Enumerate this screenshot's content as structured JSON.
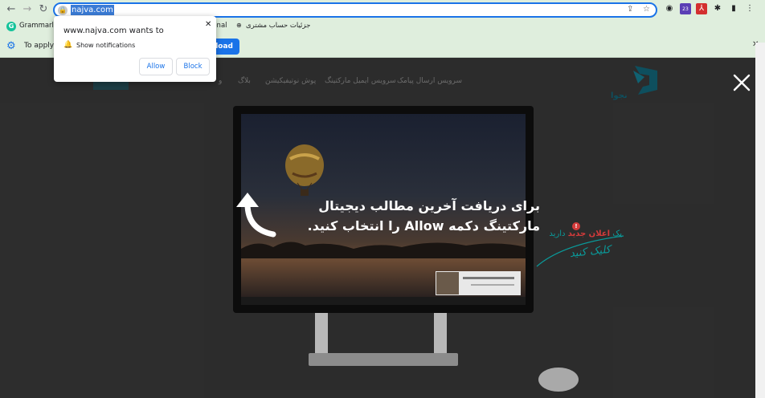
{
  "browser": {
    "url": "najva.com",
    "ext_badge": "23"
  },
  "bookmarks": {
    "grammarly": "Grammarly: F",
    "partial": "ional",
    "fa_item": "جزئیات حساب مشتری"
  },
  "infobar": {
    "text": "To apply y",
    "button_label": "load"
  },
  "popup": {
    "title": "www.najva.com wants to",
    "permission": "Show notifications",
    "allow_label": "Allow",
    "block_label": "Block"
  },
  "site": {
    "logo_text": "نجوا",
    "nav": [
      "سرویس ارسال پیامک",
      "سرویس ایمیل مارکتینگ",
      "پوش نوتیفیکیشن",
      "بلاگ",
      "و"
    ]
  },
  "overlay": {
    "headline_line1": "برای دریافت آخرین مطالب دیجیتال",
    "headline_line2": "مارکتینگ دکمه Allow را انتخاب کنید.",
    "promo_line1_a": "یک",
    "promo_line1_b": "اعلان جدید",
    "promo_line1_c": "دارید",
    "promo_line2": "کلیک کنید",
    "promo_badge": "!"
  }
}
